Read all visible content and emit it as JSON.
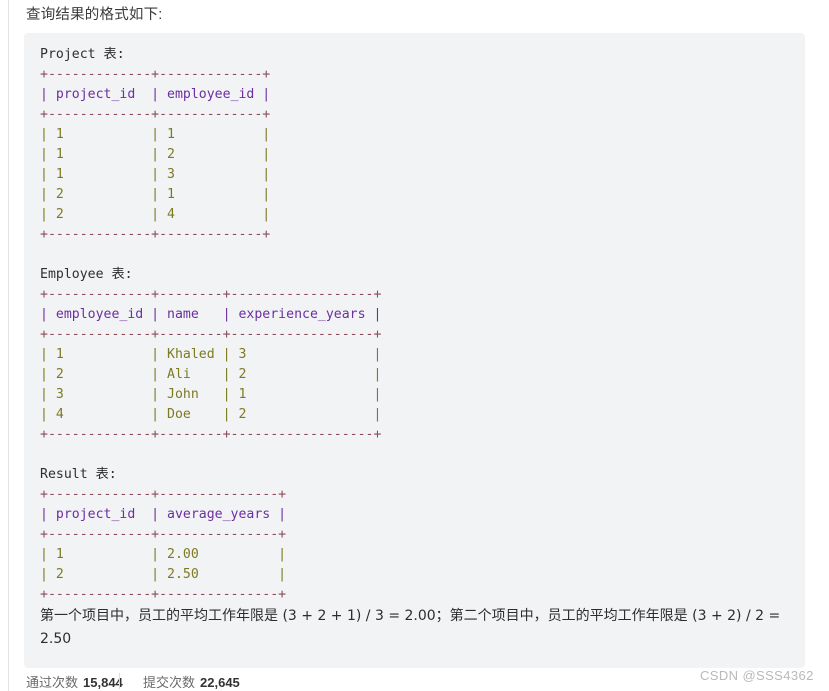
{
  "article": {
    "intro": "查询结果的格式如下:"
  },
  "code_block": {
    "sections": [
      {
        "heading": "Project 表:",
        "rule_top": "+-------------+-------------+",
        "header_row": "| project_id  | employee_id |",
        "rule_mid": "+-------------+-------------+",
        "rows": [
          "| 1           | 1           |",
          "| 1           | 2           |",
          "| 1           | 3           |",
          "| 2           | 1           |",
          "| 2           | 4           |"
        ],
        "rule_bottom": "+-------------+-------------+"
      },
      {
        "heading": "Employee 表:",
        "rule_top": "+-------------+--------+------------------+",
        "header_row": "| employee_id | name   | experience_years |",
        "rule_mid": "+-------------+--------+------------------+",
        "rows": [
          "| 1           | Khaled | 3                |",
          "| 2           | Ali    | 2                |",
          "| 3           | John   | 1                |",
          "| 4           | Doe    | 2                |"
        ],
        "rule_bottom": "+-------------+--------+------------------+"
      },
      {
        "heading": "Result 表:",
        "rule_top": "+-------------+---------------+",
        "header_row": "| project_id  | average_years |",
        "rule_mid": "+-------------+---------------+",
        "rows": [
          "| 1           | 2.00          |",
          "| 2           | 2.50          |"
        ],
        "rule_bottom": "+-------------+---------------+"
      }
    ],
    "explanation": "第一个项目中，员工的平均工作年限是 (3 + 2 + 1) / 3 = 2.00；第二个项目中，员工的平均工作年限是 (3 + 2) / 2 = 2.50"
  },
  "stats": {
    "passed_label": "通过次数",
    "passed_value": "15,844",
    "submitted_label": "提交次数",
    "submitted_value": "22,645"
  },
  "watermark": {
    "text": "CSDN @SSS4362"
  }
}
